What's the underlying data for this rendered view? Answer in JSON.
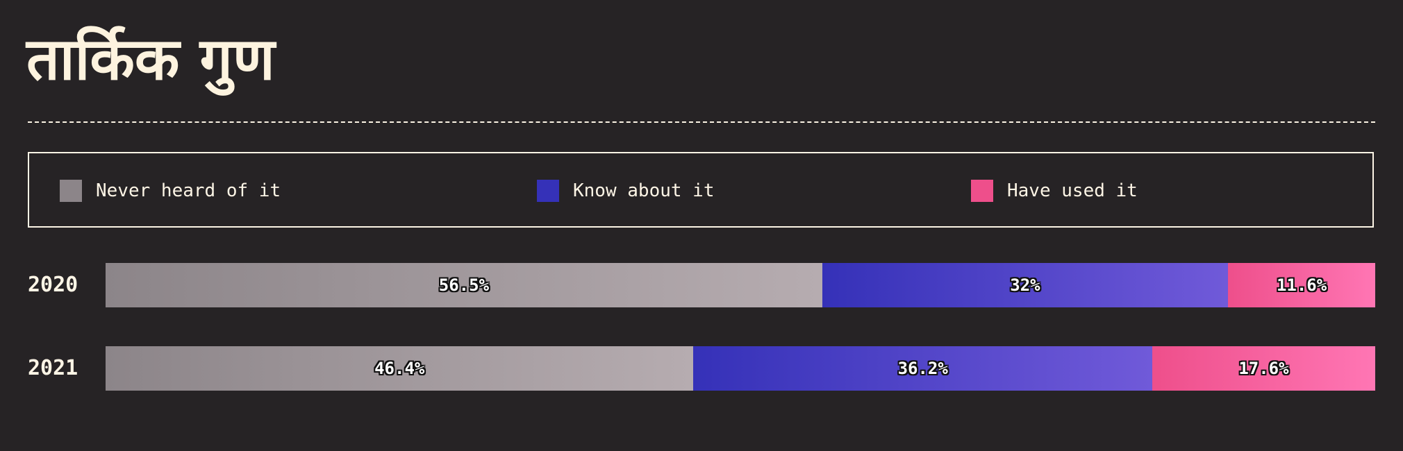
{
  "title": "तार्किक गुण",
  "chart_data": {
    "type": "bar",
    "orientation": "horizontal",
    "stacked": true,
    "categories": [
      "2020",
      "2021"
    ],
    "xlim": [
      0,
      100
    ],
    "legend_position": "top",
    "series": [
      {
        "name": "Never heard of it",
        "values": [
          56.5,
          46.4
        ],
        "labels": [
          "56.5%",
          "46.4%"
        ],
        "color": "#8c8589",
        "gradient_end": "#b6acb0"
      },
      {
        "name": "Know about it",
        "values": [
          32,
          36.2
        ],
        "labels": [
          "32%",
          "36.2%"
        ],
        "color": "#3531b8",
        "gradient_end": "#705ad9"
      },
      {
        "name": "Have used it",
        "values": [
          11.6,
          17.6
        ],
        "labels": [
          "11.6%",
          "17.6%"
        ],
        "color": "#ee4f8b",
        "gradient_end": "#ff76b4"
      }
    ]
  }
}
